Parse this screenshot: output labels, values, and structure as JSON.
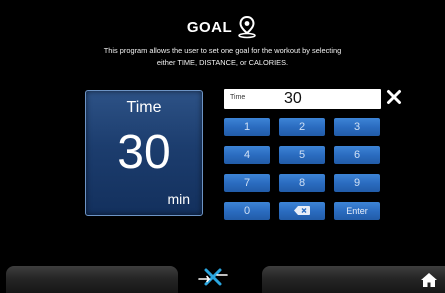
{
  "header": {
    "title": "GOAL",
    "title_icon": "location-pin-icon",
    "description_line1": "This program allows the user to set one goal for the workout by selecting",
    "description_line2": "either TIME, DISTANCE, or CALORIES."
  },
  "display": {
    "label": "Time",
    "value": "30",
    "unit": "min"
  },
  "entry": {
    "label": "Time",
    "value": "30"
  },
  "keypad": {
    "keys": [
      "1",
      "2",
      "3",
      "4",
      "5",
      "6",
      "7",
      "8",
      "9",
      "0"
    ],
    "backspace_icon": "backspace-icon",
    "enter_label": "Enter"
  },
  "footer": {
    "center_icon": "workout-x-icon",
    "home_icon": "home-icon"
  },
  "colors": {
    "background": "#000000",
    "key_blue": "#2b6cc0",
    "panel_blue": "#1c3d6e",
    "accent_cyan": "#2aa6e0"
  }
}
